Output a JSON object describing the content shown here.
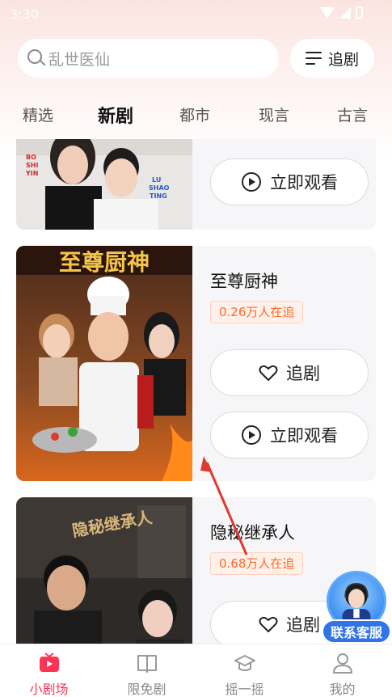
{
  "status_bar": {
    "time": "3:30"
  },
  "search": {
    "placeholder": "乱世医仙"
  },
  "follow_button": {
    "label": "追剧"
  },
  "tabs": [
    {
      "label": "精选",
      "active": false
    },
    {
      "label": "新剧",
      "active": true
    },
    {
      "label": "都市",
      "active": false
    },
    {
      "label": "现言",
      "active": false
    },
    {
      "label": "古言",
      "active": false
    }
  ],
  "dramas": [
    {
      "poster_text": [
        "BO",
        "SHI",
        "YIN",
        "LU",
        "SHAO",
        "TING"
      ],
      "watch_label": "立即观看"
    },
    {
      "title": "至尊厨神",
      "followers": "0.26万人在追",
      "poster_text": "至尊厨神",
      "follow_label": "追剧",
      "watch_label": "立即观看"
    },
    {
      "title": "隐秘继承人",
      "followers": "0.68万人在追",
      "poster_text": "隐秘继承人",
      "follow_label": "追剧"
    }
  ],
  "customer_service": {
    "label": "联系客服"
  },
  "bottom_nav": [
    {
      "label": "小剧场",
      "icon": "tv-icon",
      "active": true
    },
    {
      "label": "限免剧",
      "icon": "book-icon",
      "active": false
    },
    {
      "label": "摇一摇",
      "icon": "graduation-cap-icon",
      "active": false
    },
    {
      "label": "我的",
      "icon": "person-icon",
      "active": false
    }
  ],
  "colors": {
    "accent": "#ff3355",
    "badge_text": "#ff6a2a",
    "cs_blue": "#2f74e8"
  }
}
